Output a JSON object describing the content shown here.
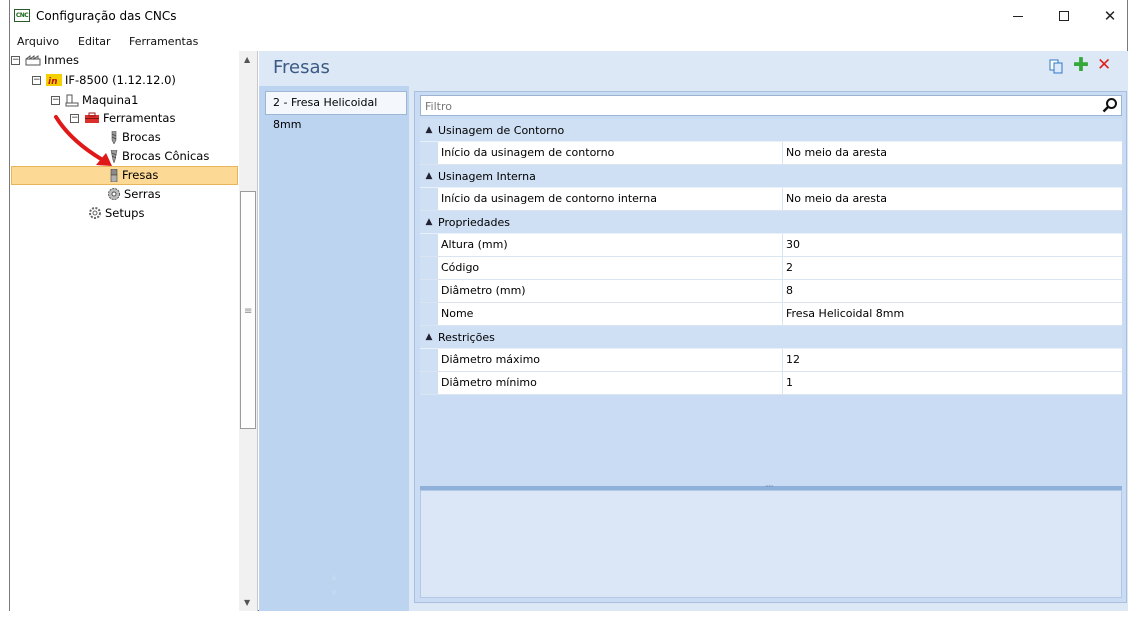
{
  "window": {
    "title": "Configuração das CNCs",
    "app_icon_text": "CNC"
  },
  "menu": [
    "Arquivo",
    "Editar",
    "Ferramentas"
  ],
  "tree": {
    "root": "Inmes",
    "machine_model": "IF-8500 (1.12.12.0)",
    "machine": "Maquina1",
    "tools_group": "Ferramentas",
    "items": [
      "Brocas",
      "Brocas Cônicas",
      "Fresas",
      "Serras"
    ],
    "setups": "Setups",
    "selected": "Fresas"
  },
  "main": {
    "section_title": "Fresas",
    "list_items": [
      "2 - Fresa Helicoidal 8mm"
    ],
    "filter_placeholder": "Filtro",
    "categories": [
      {
        "name": "Usinagem de Contorno",
        "rows": [
          {
            "name": "Início da usinagem de contorno",
            "value": "No meio da aresta"
          }
        ]
      },
      {
        "name": "Usinagem Interna",
        "rows": [
          {
            "name": "Início da usinagem de contorno interna",
            "value": "No meio da aresta"
          }
        ]
      },
      {
        "name": "Propriedades",
        "rows": [
          {
            "name": "Altura (mm)",
            "value": "30"
          },
          {
            "name": "Código",
            "value": "2"
          },
          {
            "name": "Diâmetro (mm)",
            "value": "8"
          },
          {
            "name": "Nome",
            "value": "Fresa Helicoidal 8mm"
          }
        ]
      },
      {
        "name": "Restrições",
        "rows": [
          {
            "name": "Diâmetro máximo",
            "value": "12"
          },
          {
            "name": "Diâmetro mínimo",
            "value": "1"
          }
        ]
      }
    ]
  },
  "colors": {
    "selection": "#fcd994",
    "pane_bg": "#dce8f6",
    "title_blue": "#3b5a84",
    "arrow_red": "#e01818"
  }
}
